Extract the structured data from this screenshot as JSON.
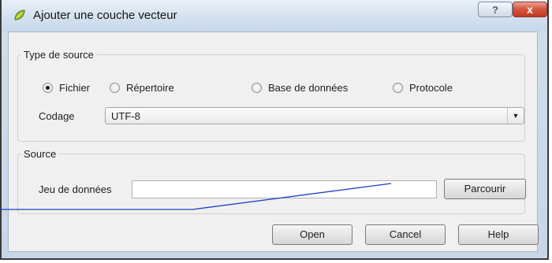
{
  "window": {
    "title": "Ajouter une couche vecteur",
    "help_glyph": "?",
    "close_glyph": "x"
  },
  "source_type": {
    "legend": "Type de source",
    "options": [
      {
        "label": "Fichier",
        "checked": true
      },
      {
        "label": "Répertoire",
        "checked": false
      },
      {
        "label": "Base de données",
        "checked": false
      },
      {
        "label": "Protocole",
        "checked": false
      }
    ],
    "encoding_label": "Codage",
    "encoding_value": "UTF-8"
  },
  "source": {
    "legend": "Source",
    "dataset_label": "Jeu de données",
    "dataset_value": "",
    "browse_label": "Parcourir"
  },
  "actions": {
    "open_label": "Open",
    "cancel_label": "Cancel",
    "help_label": "Help"
  },
  "icons": {
    "app": "qgis-icon",
    "dropdown": "chevron-down-icon"
  },
  "colors": {
    "titlebar": "#d4e1ef",
    "close_button": "#c13a22",
    "dialog_background": "#f0f0f0",
    "annotation_line": "#1f3fbf"
  }
}
